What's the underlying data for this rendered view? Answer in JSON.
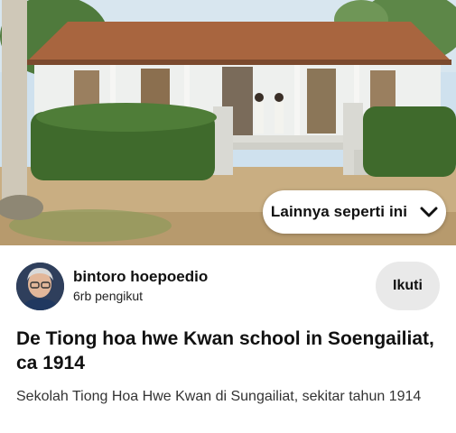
{
  "photo": {
    "alt_icon": "colorized-photo-school-building"
  },
  "more_button": {
    "label": "Lainnya seperti ini",
    "icon": "chevron-down-icon"
  },
  "creator": {
    "name": "bintoro hoepoedio",
    "followers": "6rb pengikut",
    "avatar_icon": "avatar"
  },
  "follow_button": {
    "label": "Ikuti"
  },
  "pin": {
    "title": "De Tiong hoa hwe Kwan school in Soengailiat, ca 1914",
    "description": "Sekolah Tiong Hoa Hwe Kwan di Sungailiat, sekitar tahun 1914"
  },
  "colors": {
    "text_primary": "#111111",
    "follow_bg": "#e9e9e9",
    "background": "#ffffff"
  }
}
